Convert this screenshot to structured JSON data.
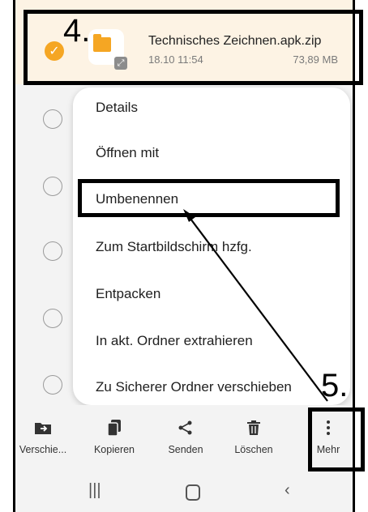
{
  "file": {
    "name": "Technisches Zeichnen.apk.zip",
    "date": "18.10 11:54",
    "size": "73,89 MB",
    "checked": true
  },
  "annotations": {
    "step4": "4.",
    "step5": "5."
  },
  "context_menu": {
    "items": [
      "Details",
      "Öffnen mit",
      "Umbenennen",
      "Zum Startbildschirm hzfg.",
      "Entpacken",
      "In akt. Ordner extrahieren",
      "Zu Sicherer Ordner verschieben"
    ],
    "highlighted": "Umbenennen"
  },
  "bottom_bar": {
    "buttons": [
      {
        "label": "Verschie...",
        "icon": "move-folder-icon"
      },
      {
        "label": "Kopieren",
        "icon": "copy-icon"
      },
      {
        "label": "Senden",
        "icon": "share-icon"
      },
      {
        "label": "Löschen",
        "icon": "trash-icon"
      },
      {
        "label": "Mehr",
        "icon": "more-vertical-icon"
      }
    ]
  },
  "colors": {
    "accent": "#f5a623",
    "selected_row": "#fdf3e4",
    "background": "#f3f3f3"
  }
}
